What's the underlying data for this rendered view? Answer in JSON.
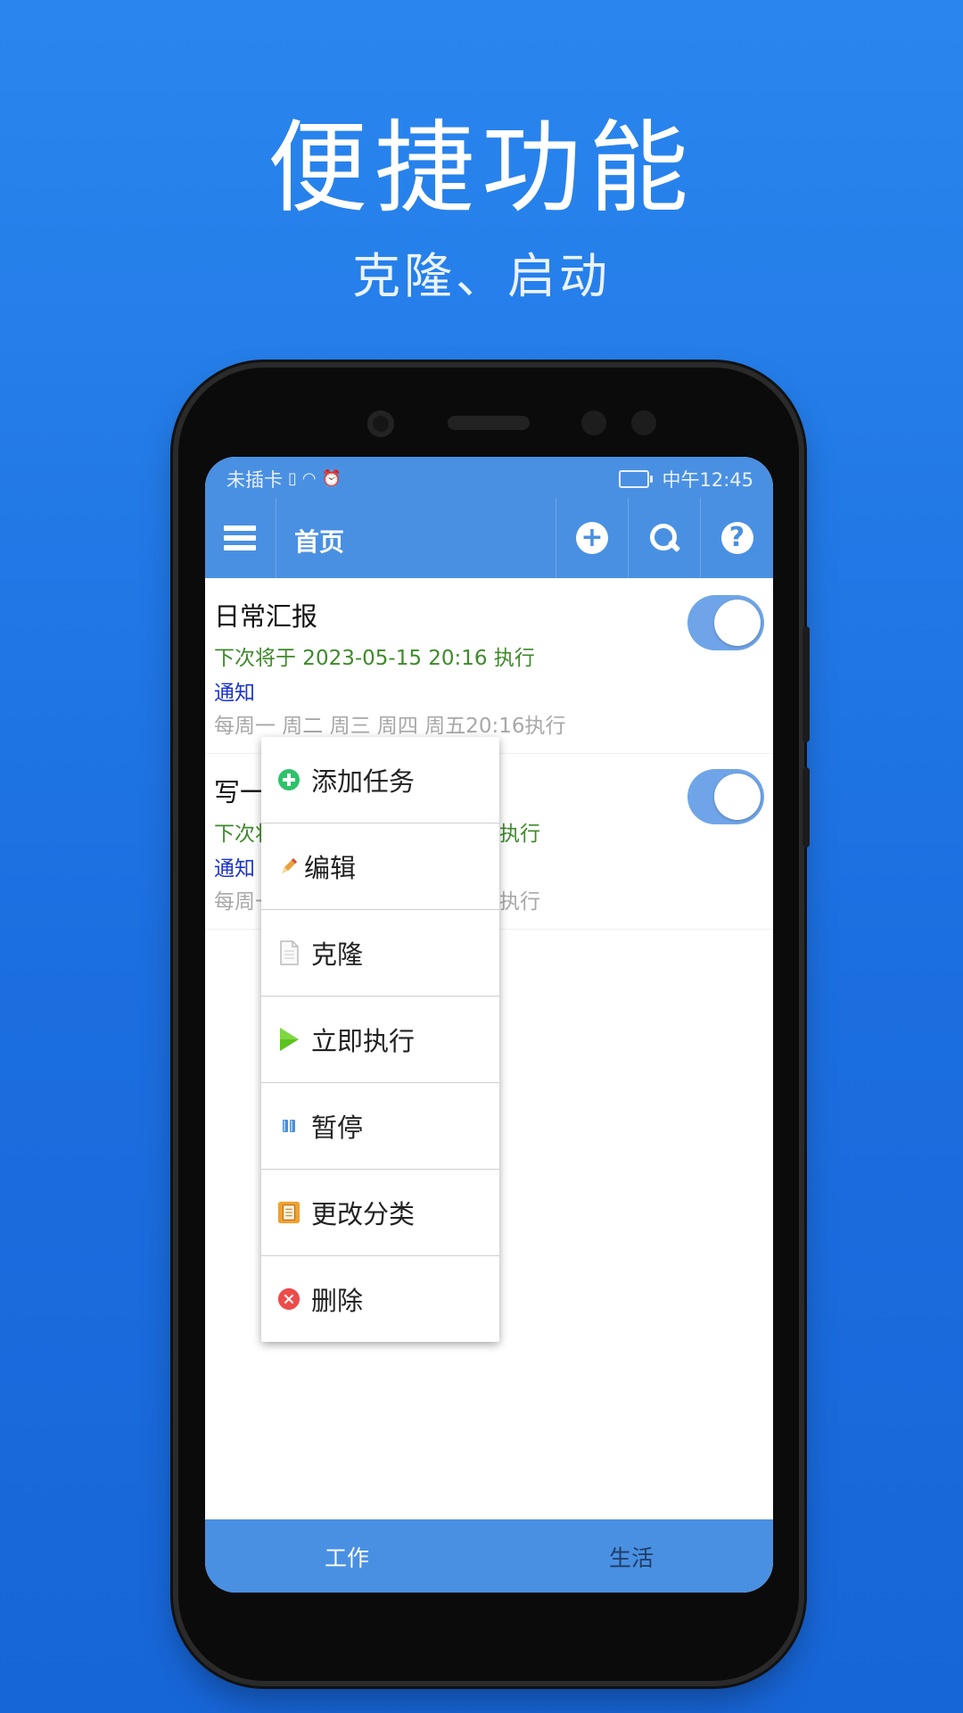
{
  "promo": {
    "title": "便捷功能",
    "subtitle": "克隆、启动"
  },
  "statusbar": {
    "carrier": "未插卡",
    "time": "中午12:45"
  },
  "toolbar": {
    "title": "首页",
    "add_icon": "+",
    "help_icon": "?"
  },
  "tasks": [
    {
      "name": "日常汇报",
      "next_run": "下次将于 2023-05-15 20:16 执行",
      "type": "通知",
      "schedule": "每周一 周二 周三 周四 周五20:16执行",
      "enabled": true
    },
    {
      "name": "写一",
      "next_run": "下次将",
      "next_run_tail": "执行",
      "type": "通知",
      "schedule": "每周一",
      "schedule_tail": "执行",
      "enabled": true
    }
  ],
  "context_menu": {
    "items": [
      {
        "label": "添加任务",
        "icon": "add-icon",
        "color": "#2ec26a"
      },
      {
        "label": "编辑",
        "icon": "pencil-icon",
        "color": "#e8a23a"
      },
      {
        "label": "克隆",
        "icon": "document-icon",
        "color": "#bbbbbb"
      },
      {
        "label": "立即执行",
        "icon": "play-icon",
        "color": "#5cc21e"
      },
      {
        "label": "暂停",
        "icon": "pause-icon",
        "color": "#4a8fd8"
      },
      {
        "label": "更改分类",
        "icon": "category-icon",
        "color": "#f0a030"
      },
      {
        "label": "删除",
        "icon": "delete-icon",
        "color": "#ee4b4b"
      }
    ]
  },
  "bottom_tabs": [
    {
      "label": "工作",
      "active": true
    },
    {
      "label": "生活",
      "active": false
    }
  ],
  "colors": {
    "background": "#1f72e4",
    "app_bar": "#4a90e2",
    "toggle_on": "#6fa5e8",
    "next_run_text": "#3e8a2a",
    "type_text": "#1a34c8"
  }
}
